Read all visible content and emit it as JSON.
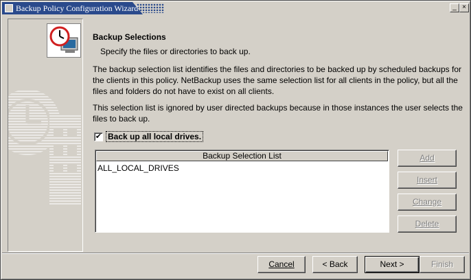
{
  "window": {
    "title": "Backup Policy Configuration Wizard",
    "min_glyph": "_",
    "close_glyph": "×"
  },
  "banner": {
    "icon": "clock-computer-icon",
    "art": "clock-backdrop-art"
  },
  "main": {
    "heading": "Backup Selections",
    "subheading": "Specify the files or directories to back up.",
    "paragraph1": "The backup selection list identifies the files and directories to be backed up by scheduled backups for the clients in this policy. NetBackup uses the same selection list for all clients in the policy, but all the files and folders do not have to exist on all clients.",
    "paragraph2": "This selection list is ignored by user directed backups because in those instances the user selects the files to back up.",
    "checkbox": {
      "label": "Back up all local drives.",
      "checked": true,
      "mark": "✔"
    },
    "list": {
      "header": "Backup Selection List",
      "items": [
        "ALL_LOCAL_DRIVES"
      ]
    }
  },
  "side_buttons": {
    "add": "Add",
    "insert": "Insert",
    "change": "Change",
    "delete": "Delete"
  },
  "footer_buttons": {
    "cancel": "Cancel",
    "back": "< Back",
    "next": "Next >",
    "finish": "Finish"
  }
}
